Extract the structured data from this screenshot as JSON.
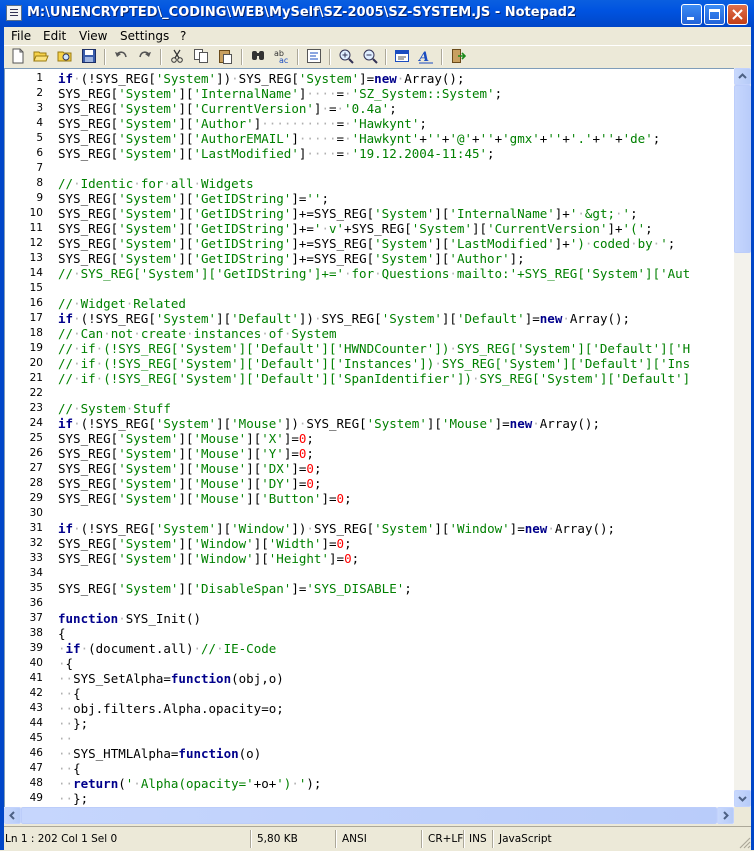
{
  "window": {
    "title": "M:\\UNENCRYPTED\\_CODING\\WEB\\MySelf\\SZ-2005\\SZ-SYSTEM.JS - Notepad2",
    "buttons": [
      "minimize-icon",
      "maximize-icon",
      "close-icon"
    ]
  },
  "menu": {
    "file": "File",
    "edit": "Edit",
    "view": "View",
    "settings": "Settings",
    "help": "?"
  },
  "toolbar": {
    "icons": [
      "new-file-icon",
      "open-folder-icon",
      "browse-icon",
      "save-icon",
      "undo-icon",
      "redo-icon",
      "cut-icon",
      "copy-icon",
      "paste-icon",
      "find-icon",
      "replace-icon",
      "word-wrap-icon",
      "zoom-in-icon",
      "zoom-out-icon",
      "scheme-icon",
      "font-icon",
      "exit-icon"
    ]
  },
  "editor": {
    "lines": [
      {
        "n": "1",
        "t": "if·(!SYS_REG['System'])·SYS_REG['System']=new·Array();"
      },
      {
        "n": "2",
        "t": "SYS_REG['System']['InternalName']····=·'SZ_System::System';"
      },
      {
        "n": "3",
        "t": "SYS_REG['System']['CurrentVersion']·=·'0.4a';"
      },
      {
        "n": "4",
        "t": "SYS_REG['System']['Author']··········=·'Hawkynt';"
      },
      {
        "n": "5",
        "t": "SYS_REG['System']['AuthorEMAIL']·····=·'Hawkynt'+''+'@'+''+'gmx'+''+'.'+''+'de';"
      },
      {
        "n": "6",
        "t": "SYS_REG['System']['LastModified']····=·'19.12.2004-11:45';"
      },
      {
        "n": "7",
        "t": ""
      },
      {
        "n": "8",
        "t": "//·Identic·for·all·Widgets"
      },
      {
        "n": "9",
        "t": "SYS_REG['System']['GetIDString']='';"
      },
      {
        "n": "10",
        "t": "SYS_REG['System']['GetIDString']+=SYS_REG['System']['InternalName']+'·&gt;·';"
      },
      {
        "n": "11",
        "t": "SYS_REG['System']['GetIDString']+='·v'+SYS_REG['System']['CurrentVersion']+'(';"
      },
      {
        "n": "12",
        "t": "SYS_REG['System']['GetIDString']+=SYS_REG['System']['LastModified']+')·coded·by·';"
      },
      {
        "n": "13",
        "t": "SYS_REG['System']['GetIDString']+=SYS_REG['System']['Author'];"
      },
      {
        "n": "14",
        "t": "//·SYS_REG['System']['GetIDString']+='·for·Questions·mailto:'+SYS_REG['System']['Aut"
      },
      {
        "n": "15",
        "t": ""
      },
      {
        "n": "16",
        "t": "//·Widget·Related"
      },
      {
        "n": "17",
        "t": "if·(!SYS_REG['System']['Default'])·SYS_REG['System']['Default']=new·Array();"
      },
      {
        "n": "18",
        "t": "//·Can·not·create·instances·of·System"
      },
      {
        "n": "19",
        "t": "//·if·(!SYS_REG['System']['Default']['HWNDCounter'])·SYS_REG['System']['Default']['H"
      },
      {
        "n": "20",
        "t": "//·if·(!SYS_REG['System']['Default']['Instances'])·SYS_REG['System']['Default']['Ins"
      },
      {
        "n": "21",
        "t": "//·if·(!SYS_REG['System']['Default']['SpanIdentifier'])·SYS_REG['System']['Default']"
      },
      {
        "n": "22",
        "t": ""
      },
      {
        "n": "23",
        "t": "//·System·Stuff"
      },
      {
        "n": "24",
        "t": "if·(!SYS_REG['System']['Mouse'])·SYS_REG['System']['Mouse']=new·Array();"
      },
      {
        "n": "25",
        "t": "SYS_REG['System']['Mouse']['X']=0;"
      },
      {
        "n": "26",
        "t": "SYS_REG['System']['Mouse']['Y']=0;"
      },
      {
        "n": "27",
        "t": "SYS_REG['System']['Mouse']['DX']=0;"
      },
      {
        "n": "28",
        "t": "SYS_REG['System']['Mouse']['DY']=0;"
      },
      {
        "n": "29",
        "t": "SYS_REG['System']['Mouse']['Button']=0;"
      },
      {
        "n": "30",
        "t": ""
      },
      {
        "n": "31",
        "t": "if·(!SYS_REG['System']['Window'])·SYS_REG['System']['Window']=new·Array();"
      },
      {
        "n": "32",
        "t": "SYS_REG['System']['Window']['Width']=0;"
      },
      {
        "n": "33",
        "t": "SYS_REG['System']['Window']['Height']=0;"
      },
      {
        "n": "34",
        "t": ""
      },
      {
        "n": "35",
        "t": "SYS_REG['System']['DisableSpan']='SYS_DISABLE';"
      },
      {
        "n": "36",
        "t": ""
      },
      {
        "n": "37",
        "t": "function·SYS_Init()"
      },
      {
        "n": "38",
        "t": "{"
      },
      {
        "n": "39",
        "t": "·if·(document.all)·//·IE-Code"
      },
      {
        "n": "40",
        "t": "·{"
      },
      {
        "n": "41",
        "t": "··SYS_SetAlpha=function(obj,o)"
      },
      {
        "n": "42",
        "t": "··{"
      },
      {
        "n": "43",
        "t": "··obj.filters.Alpha.opacity=o;"
      },
      {
        "n": "44",
        "t": "··};"
      },
      {
        "n": "45",
        "t": "··"
      },
      {
        "n": "46",
        "t": "··SYS_HTMLAlpha=function(o)"
      },
      {
        "n": "47",
        "t": "··{"
      },
      {
        "n": "48",
        "t": "··return('·Alpha(opacity='+o+')·');"
      },
      {
        "n": "49",
        "t": "··};"
      }
    ]
  },
  "status": {
    "position": "Ln 1 : 202   Col 1   Sel 0",
    "size": "5,80 KB",
    "encoding": "ANSI",
    "eol": "CR+LF",
    "ovr": "INS",
    "lexer": "JavaScript"
  }
}
